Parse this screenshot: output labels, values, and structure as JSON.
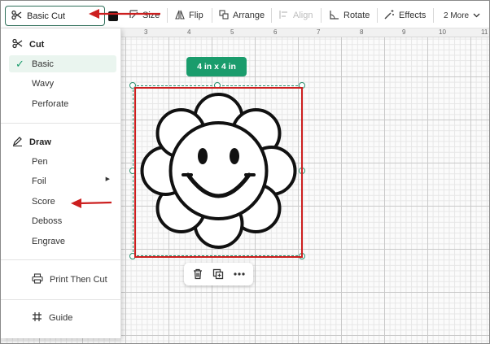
{
  "toolbar": {
    "operation_label": "Basic Cut",
    "size_label": "Size",
    "flip_label": "Flip",
    "arrange_label": "Arrange",
    "align_label": "Align",
    "rotate_label": "Rotate",
    "effects_label": "Effects",
    "more_label": "2 More",
    "swatch_color": "#111111"
  },
  "ruler": {
    "ticks": [
      "3",
      "4",
      "5",
      "6",
      "7",
      "8",
      "9",
      "10",
      "11"
    ]
  },
  "canvas": {
    "size_badge": "4 in x 4 in",
    "badge_color": "#1a9c6c",
    "annotation_color": "#cc1f1f"
  },
  "menu": {
    "cut_header": "Cut",
    "cut_items": [
      "Basic",
      "Wavy",
      "Perforate"
    ],
    "selected_item": "Basic",
    "draw_header": "Draw",
    "draw_items": [
      "Pen",
      "Foil",
      "Score",
      "Deboss",
      "Engrave"
    ],
    "print_then_cut": "Print Then Cut",
    "guide": "Guide"
  },
  "mini_toolbar": {
    "icons": [
      "trash-icon",
      "duplicate-icon",
      "more-icon"
    ]
  }
}
